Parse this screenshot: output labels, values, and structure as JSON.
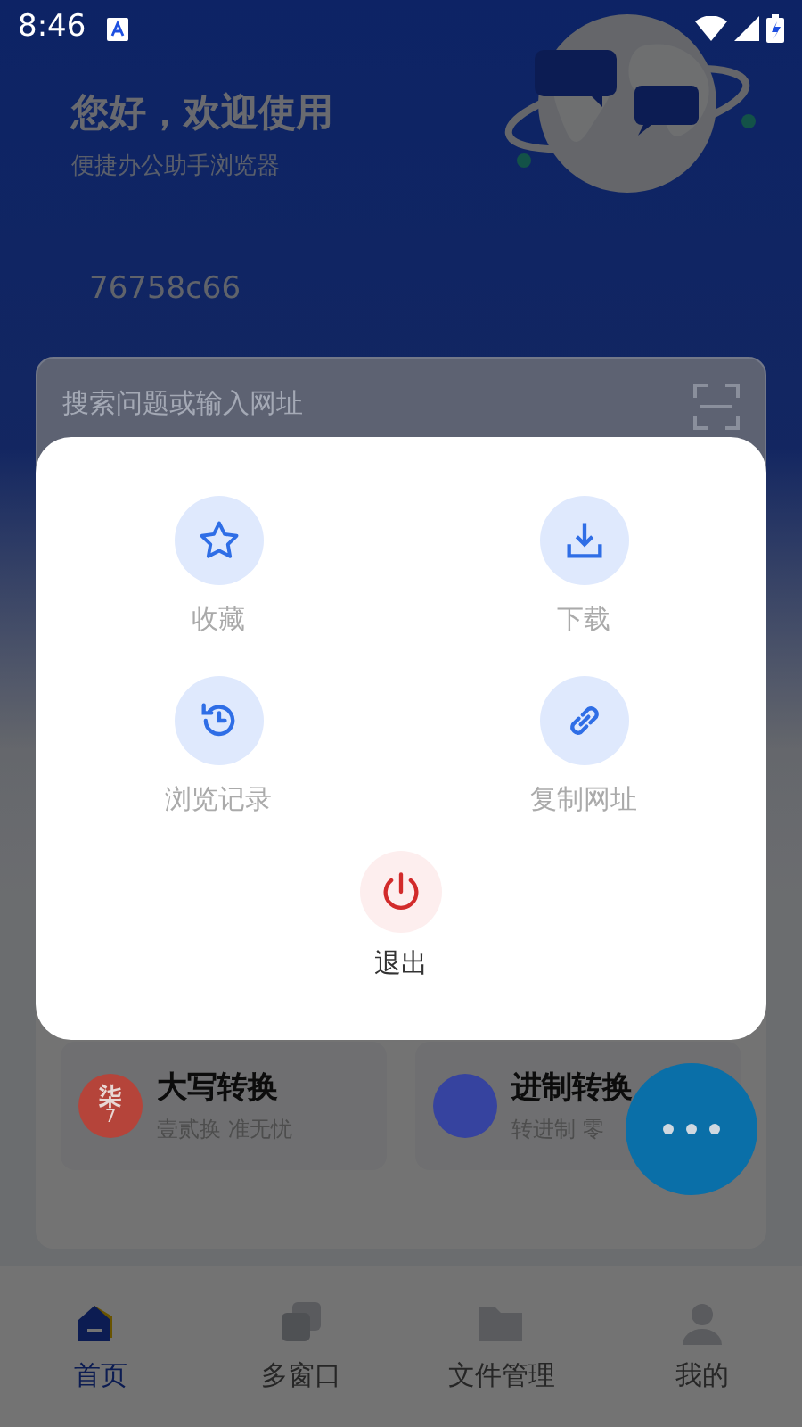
{
  "status_bar": {
    "time": "8:46"
  },
  "header": {
    "title": "您好，欢迎使用",
    "subtitle": "便捷办公助手浏览器",
    "code": "76758c66"
  },
  "search": {
    "placeholder": "搜索问题或输入网址"
  },
  "tools": [
    {
      "title": "大写转换",
      "subtitle": "壹贰换 准无忧",
      "color": "#b5443a",
      "glyphs": [
        "柒",
        "7"
      ]
    },
    {
      "title": "进制转换",
      "subtitle": "转进制 零",
      "color": "#36439f"
    }
  ],
  "dialog": {
    "items": [
      {
        "label": "收藏",
        "kind": "normal"
      },
      {
        "label": "下载",
        "kind": "normal"
      },
      {
        "label": "浏览记录",
        "kind": "normal"
      },
      {
        "label": "复制网址",
        "kind": "normal"
      },
      {
        "label": "退出",
        "kind": "danger"
      }
    ]
  },
  "bottom_nav": [
    {
      "label": "首页",
      "selected": true
    },
    {
      "label": "多窗口",
      "selected": false
    },
    {
      "label": "文件管理",
      "selected": false
    },
    {
      "label": "我的",
      "selected": false
    }
  ]
}
